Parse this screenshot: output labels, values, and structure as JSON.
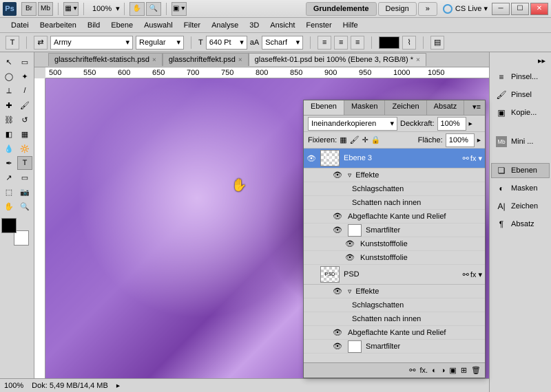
{
  "titlebar": {
    "zoom": "100%",
    "br": "Br",
    "mb": "Mb"
  },
  "workspaces": {
    "active": "Grundelemente",
    "second": "Design",
    "more": "»",
    "cslive": "CS Live ▾"
  },
  "menu": [
    "Datei",
    "Bearbeiten",
    "Bild",
    "Ebene",
    "Auswahl",
    "Filter",
    "Analyse",
    "3D",
    "Ansicht",
    "Fenster",
    "Hilfe"
  ],
  "options": {
    "font": "Army",
    "style": "Regular",
    "size": "640 Pt",
    "aa_label": "aA",
    "aa": "Scharf"
  },
  "doctabs": [
    {
      "label": "glasschrifteffekt-statisch.psd",
      "active": false
    },
    {
      "label": "glasschrifteffekt.psd",
      "active": false
    },
    {
      "label": "glaseffekt-01.psd bei 100% (Ebene 3, RGB/8) *",
      "active": true
    }
  ],
  "ruler_marks": [
    "500",
    "550",
    "600",
    "650",
    "700",
    "750",
    "800",
    "850",
    "900",
    "950",
    "1000",
    "1050"
  ],
  "status": {
    "zoom": "100%",
    "doc": "Dok: 5,49 MB/14,4 MB"
  },
  "dock": [
    "Pinsel...",
    "Pinsel",
    "Kopie...",
    "Mini ...",
    "Ebenen",
    "Masken",
    "Zeichen",
    "Absatz"
  ],
  "panel": {
    "tabs": [
      "Ebenen",
      "Masken",
      "Zeichen",
      "Absatz"
    ],
    "blend": "Ineinanderkopieren",
    "opacity_label": "Deckkraft:",
    "opacity": "100%",
    "lock_label": "Fixieren:",
    "fill_label": "Fläche:",
    "fill": "100%",
    "layers": [
      {
        "name": "Ebene 3",
        "selected": true,
        "fx": true,
        "link": true
      },
      {
        "name": "PSD",
        "selected": false,
        "fx": true,
        "link": true
      }
    ],
    "effects": {
      "title": "Effekte",
      "items": [
        "Schlagschatten",
        "Schatten nach innen",
        "Abgeflachte Kante und Relief"
      ],
      "smart": "Smartfilter",
      "smartitems": [
        "Kunststofffolie",
        "Kunststofffolie"
      ]
    }
  }
}
